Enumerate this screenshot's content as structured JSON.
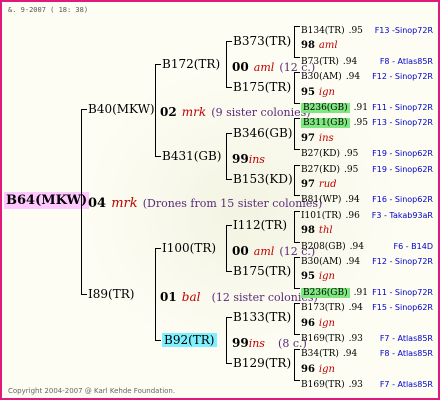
{
  "header": "&. 9-2007 ( 18: 38)",
  "footer": "Copyright 2004-2007 @ Karl Kehde Foundation.",
  "root": {
    "label": "B64(MKW)",
    "year": "04",
    "queen": "mrk",
    "note": "(Drones from 15 sister colonies)"
  },
  "gen1": {
    "top": {
      "label": "B40(MKW)",
      "year": "02",
      "queen": "mrk",
      "note": "(9 sister colonies)"
    },
    "bottom": {
      "label": "I89(TR)",
      "year": "01",
      "queen": "bal",
      "note": "(12 sister colonies)"
    }
  },
  "gen2": [
    {
      "label": "B172(TR)",
      "year": "00",
      "queen": "aml",
      "note": "(12 c.)"
    },
    {
      "label": "B431(GB)",
      "year": "99",
      "queen": "ins",
      "note": ""
    },
    {
      "label": "I100(TR)",
      "year": "00",
      "queen": "aml",
      "note": "(12 c.)"
    },
    {
      "label": "B92(TR)",
      "year": "99",
      "queen": "ins",
      "note": "(8 c.)"
    }
  ],
  "gen3": [
    {
      "label": "B373(TR)"
    },
    {
      "label": "B175(TR)"
    },
    {
      "label": "B346(GB)"
    },
    {
      "label": "B153(KD)"
    },
    {
      "label": "I112(TR)"
    },
    {
      "label": "B175(TR)"
    },
    {
      "label": "B133(TR)"
    },
    {
      "label": "B129(TR)"
    }
  ],
  "gen4": [
    {
      "label": "B134(TR)",
      "score": ".95",
      "file": "F13 -Sinop72R"
    },
    {
      "year": "98",
      "queen": "aml"
    },
    {
      "label": "B73(TR)",
      "score": ".94",
      "file": "F8 - Atlas85R"
    },
    {
      "label": "B30(AM)",
      "score": ".94",
      "file": "F12 - Sinop72R"
    },
    {
      "year": "95",
      "queen": "ign"
    },
    {
      "label": "B236(GB)",
      "score": ".91",
      "file": "F11 - Sinop72R"
    },
    {
      "label": "B311(GB)",
      "score": ".95",
      "file": "F13 - Sinop72R"
    },
    {
      "year": "97",
      "queen": "ins"
    },
    {
      "label": "B27(KD)",
      "score": ".95",
      "file": "F19 - Sinop62R"
    },
    {
      "label": "B27(KD)",
      "score": ".95",
      "file": "F19 - Sinop62R"
    },
    {
      "year": "97",
      "queen": "rud"
    },
    {
      "label": "B81(WP)",
      "score": ".94",
      "file": "F16 - Sinop62R"
    },
    {
      "label": "I101(TR)",
      "score": ".96",
      "file": "F3 - Takab93aR"
    },
    {
      "year": "98",
      "queen": "thl"
    },
    {
      "label": "B208(GB)",
      "score": ".94",
      "file": "F6 - B14D"
    },
    {
      "label": "B30(AM)",
      "score": ".94",
      "file": "F12 - Sinop72R"
    },
    {
      "year": "95",
      "queen": "ign"
    },
    {
      "label": "B236(GB)",
      "score": ".91",
      "file": "F11 - Sinop72R"
    },
    {
      "label": "B173(TR)",
      "score": ".94",
      "file": "F15 - Sinop62R"
    },
    {
      "year": "96",
      "queen": "ign"
    },
    {
      "label": "B169(TR)",
      "score": ".93",
      "file": "F7 - Atlas85R"
    },
    {
      "label": "B34(TR)",
      "score": ".94",
      "file": "F8 - Atlas85R"
    },
    {
      "year": "96",
      "queen": "ign"
    },
    {
      "label": "B169(TR)",
      "score": ".93",
      "file": "F7 - Atlas85R"
    }
  ]
}
